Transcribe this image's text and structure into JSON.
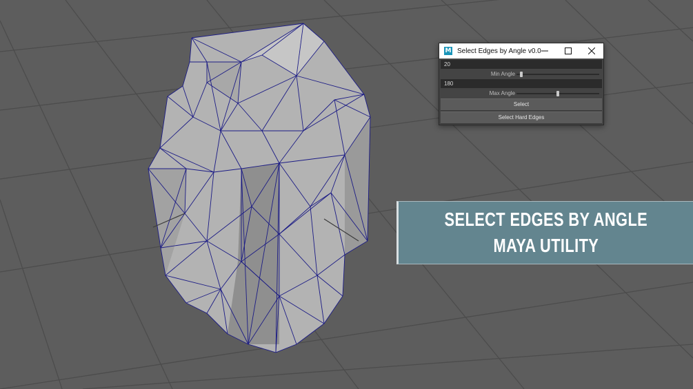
{
  "window": {
    "title": "Select Edges by Angle v0.0",
    "app_icon_letter": "M"
  },
  "controls": {
    "min_angle_value": "20",
    "min_angle_label": "Min Angle",
    "min_angle_slider": 0.055,
    "max_angle_value": "180",
    "max_angle_label": "Max Angle",
    "max_angle_slider": 0.5,
    "select_label": "Select",
    "select_hard_edges_label": "Select Hard Edges"
  },
  "banner": {
    "line1": "SELECT EDGES BY ANGLE",
    "line2": "MAYA UTILITY"
  },
  "colors": {
    "viewport_background": "#5d5d5d",
    "grid_line": "#4a4a4a",
    "mesh_fill": "#b9b9b9",
    "mesh_wire": "#1a1a7a",
    "banner_background": "#63858f"
  },
  "icons": [
    "maya-app-icon",
    "minimize-icon",
    "maximize-icon",
    "close-icon"
  ]
}
